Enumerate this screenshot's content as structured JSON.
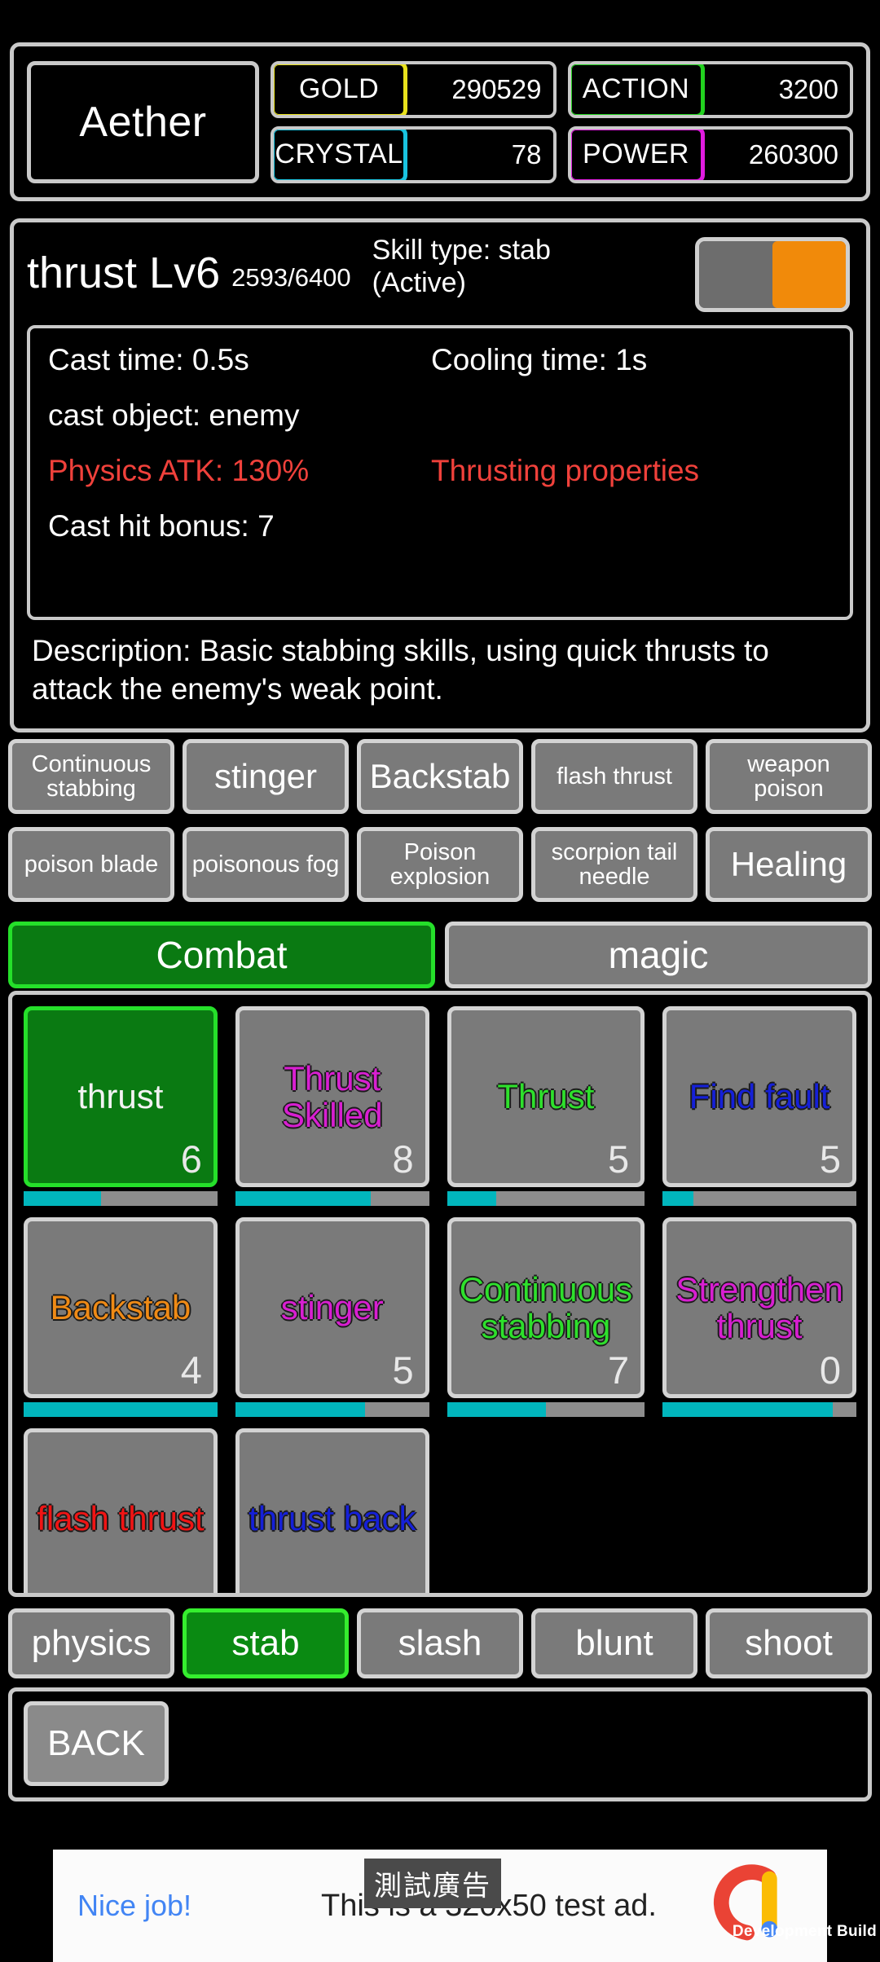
{
  "status_bar": {
    "player_name": "Aether",
    "stats": [
      {
        "label": "GOLD",
        "value": "290529",
        "color": "#e8e11c"
      },
      {
        "label": "ACTION",
        "value": "3200",
        "color": "#22d21f"
      },
      {
        "label": "CRYSTAL",
        "value": "78",
        "color": "#19c3e0"
      },
      {
        "label": "POWER",
        "value": "260300",
        "color": "#e11ce0"
      }
    ]
  },
  "skill_detail": {
    "title": "thrust Lv6",
    "exp": "2593/6400",
    "skill_type": "Skill type: stab\n(Active)",
    "skill_type_line1": "Skill type: stab",
    "skill_type_line2": "(Active)",
    "toggle_state": "on",
    "toggle_color": "#f18a0a",
    "cast_time": "Cast time: 0.5s",
    "cooling_time": "Cooling time: 1s",
    "cast_object": "cast object: enemy",
    "physics_atk": "Physics ATK: 130%",
    "properties": "Thrusting properties",
    "cast_hit_bonus": "Cast hit bonus: 7",
    "highlight_color": "#f0413b",
    "description": "Description: Basic stabbing skills, using quick thrusts to attack the enemy's weak point."
  },
  "chip_rows": [
    [
      {
        "label": "Continuous stabbing",
        "size": "small"
      },
      {
        "label": "stinger",
        "size": "big"
      },
      {
        "label": "Backstab",
        "size": "big"
      },
      {
        "label": "flash thrust",
        "size": "small"
      },
      {
        "label": "weapon poison",
        "size": "small"
      }
    ],
    [
      {
        "label": "poison blade",
        "size": "small"
      },
      {
        "label": "poisonous fog",
        "size": "small"
      },
      {
        "label": "Poison explosion",
        "size": "small"
      },
      {
        "label": "scorpion tail needle",
        "size": "small"
      },
      {
        "label": "Healing",
        "size": "big"
      }
    ]
  ],
  "category_tabs": [
    {
      "label": "Combat",
      "active": true
    },
    {
      "label": "magic",
      "active": false
    }
  ],
  "skill_grid": [
    {
      "name": "thrust",
      "level": "6",
      "color": "#f2f2f2",
      "active": true,
      "progress": 40
    },
    {
      "name": "Thrust Skilled",
      "level": "8",
      "color": "#d81fd1",
      "active": false,
      "progress": 70
    },
    {
      "name": "Thrust",
      "level": "5",
      "color": "#2ee02c",
      "active": false,
      "progress": 25
    },
    {
      "name": "Find fault",
      "level": "5",
      "color": "#1520d8",
      "active": false,
      "progress": 16
    },
    {
      "name": "Backstab",
      "level": "4",
      "color": "#ef8a15",
      "active": false,
      "progress": 100
    },
    {
      "name": "stinger",
      "level": "5",
      "color": "#d81fd1",
      "active": false,
      "progress": 67
    },
    {
      "name": "Continuous stabbing",
      "level": "7",
      "color": "#2ee02c",
      "active": false,
      "progress": 50
    },
    {
      "name": "Strengthen thrust",
      "level": "0",
      "color": "#d81fd1",
      "active": false,
      "progress": 88
    },
    {
      "name": "flash thrust",
      "level": "",
      "color": "#f01414",
      "active": false,
      "progress": 0
    },
    {
      "name": "thrust back",
      "level": "",
      "color": "#1520d8",
      "active": false,
      "progress": 0
    }
  ],
  "filters": [
    {
      "label": "physics",
      "active": false
    },
    {
      "label": "stab",
      "active": true
    },
    {
      "label": "slash",
      "active": false
    },
    {
      "label": "blunt",
      "active": false
    },
    {
      "label": "shoot",
      "active": false
    }
  ],
  "back_button": {
    "label": "BACK"
  },
  "ad": {
    "cta": "Nice job!",
    "body": "This is a 320x50 test ad.",
    "overlay": "測試廣告",
    "dev_build": "Development Build"
  }
}
